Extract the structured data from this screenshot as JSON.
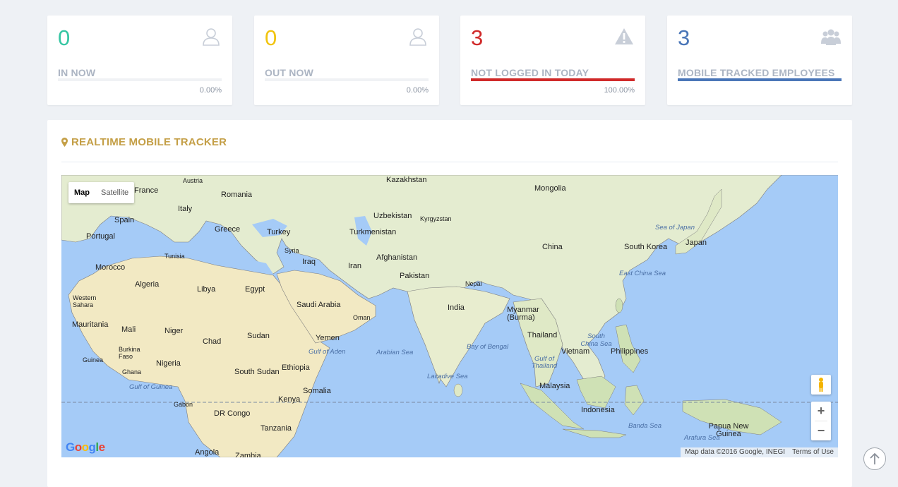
{
  "cards": [
    {
      "value": "0",
      "label": "IN NOW",
      "percent": "0.00%",
      "fill": 0,
      "color": "#36c6a3",
      "icon": "user-outline-icon"
    },
    {
      "value": "0",
      "label": "OUT NOW",
      "percent": "0.00%",
      "fill": 0,
      "color": "#f1c40f",
      "icon": "user-outline-icon"
    },
    {
      "value": "3",
      "label": "NOT LOGGED IN TODAY",
      "percent": "100.00%",
      "fill": 1,
      "color": "#d02a2a",
      "icon": "warning-icon"
    },
    {
      "value": "3",
      "label": "MOBILE TRACKED EMPLOYEES",
      "percent": "",
      "fill": 1,
      "color": "#4a76b8",
      "icon": "users-group-icon"
    }
  ],
  "tracker": {
    "title": "REALTIME MOBILE TRACKER",
    "title_icon": "map-marker-icon",
    "map_type": {
      "map": "Map",
      "satellite": "Satellite"
    },
    "zoom_in": "+",
    "zoom_out": "−",
    "logo": "Google",
    "attribution": "Map data ©2016 Google, INEGI",
    "terms": "Terms of Use",
    "labels": [
      {
        "t": "Kazakhstan"
      },
      {
        "t": "Mongolia"
      },
      {
        "t": "Austria"
      },
      {
        "t": "France"
      },
      {
        "t": "Romania"
      },
      {
        "t": "Italy"
      },
      {
        "t": "Uzbekistan"
      },
      {
        "t": "Kyrgyzstan"
      },
      {
        "t": "Spain"
      },
      {
        "t": "Turkmenistan"
      },
      {
        "t": "Greece"
      },
      {
        "t": "Turkey"
      },
      {
        "t": "Sea of Japan"
      },
      {
        "t": "Portugal"
      },
      {
        "t": "China"
      },
      {
        "t": "South Korea"
      },
      {
        "t": "Japan"
      },
      {
        "t": "Tunisia"
      },
      {
        "t": "Syria"
      },
      {
        "t": "Afghanistan"
      },
      {
        "t": "Morocco"
      },
      {
        "t": "Iraq"
      },
      {
        "t": "Iran"
      },
      {
        "t": "Pakistan"
      },
      {
        "t": "East China Sea"
      },
      {
        "t": "Algeria"
      },
      {
        "t": "Libya"
      },
      {
        "t": "Egypt"
      },
      {
        "t": "Nepal"
      },
      {
        "t": "Saudi Arabia"
      },
      {
        "t": "Western Sahara"
      },
      {
        "t": "India"
      },
      {
        "t": "Myanmar (Burma)"
      },
      {
        "t": "Oman"
      },
      {
        "t": "Mauritania"
      },
      {
        "t": "Mali"
      },
      {
        "t": "Niger"
      },
      {
        "t": "Sudan"
      },
      {
        "t": "Yemen"
      },
      {
        "t": "Thailand"
      },
      {
        "t": "South China Sea"
      },
      {
        "t": "Chad"
      },
      {
        "t": "Bay of Bengal"
      },
      {
        "t": "Burkina Faso"
      },
      {
        "t": "Vietnam"
      },
      {
        "t": "Philippines"
      },
      {
        "t": "Gulf of Aden"
      },
      {
        "t": "Arabian Sea"
      },
      {
        "t": "Guinea"
      },
      {
        "t": "Ghana"
      },
      {
        "t": "Nigeria"
      },
      {
        "t": "Ethiopia"
      },
      {
        "t": "Gulf of Thailand"
      },
      {
        "t": "South Sudan"
      },
      {
        "t": "Lacadive Sea"
      },
      {
        "t": "Gulf of Guinea"
      },
      {
        "t": "Malaysia"
      },
      {
        "t": "Somalia"
      },
      {
        "t": "Gabon"
      },
      {
        "t": "Kenya"
      },
      {
        "t": "Indonesia"
      },
      {
        "t": "DR Congo"
      },
      {
        "t": "Banda Sea"
      },
      {
        "t": "Papua New Guinea"
      },
      {
        "t": "Tanzania"
      },
      {
        "t": "Arafura Sea"
      },
      {
        "t": "Angola"
      },
      {
        "t": "Zambia"
      }
    ]
  }
}
